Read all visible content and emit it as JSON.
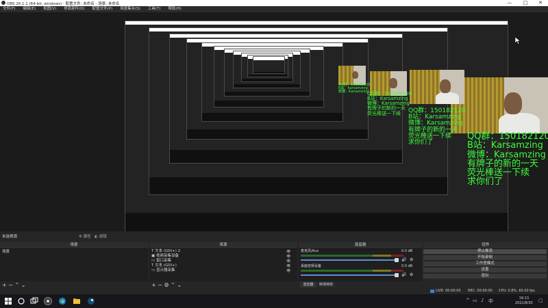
{
  "window": {
    "title": "OBS 26.1.1 (64-bit, windows) - 配置文件: 未命名 - 场景: 未命名",
    "minimize": "—",
    "maximize": "□",
    "close": "✕"
  },
  "menu": [
    "文件(F)",
    "编辑(E)",
    "视图(V)",
    "停靠部件(D)",
    "配置文件(P)",
    "场景集合(S)",
    "工具(T)",
    "帮助(H)"
  ],
  "preview": {
    "overlay_lines": [
      "QQ群：150182120",
      "B站：Karsamzing",
      "微博：Karsamzing",
      "有牌子的新的一天",
      "荧光棒送一下续",
      "求你们了"
    ],
    "text_color": "#3cff3c"
  },
  "dock": {
    "no_source": "未选择源",
    "properties_label": "属性",
    "filters_label": "滤镜",
    "scenes": {
      "title": "场景",
      "items": [
        "场景"
      ]
    },
    "sources": {
      "title": "来源",
      "items": [
        "文本 (GDI+) 2",
        "视频采集设备",
        "窗口采集",
        "文本 (GDI+)",
        "显示器采集"
      ]
    },
    "mixer": {
      "title": "混音器",
      "channels": [
        {
          "name": "麦克风/Aux",
          "db": "0.0 dB"
        },
        {
          "name": "桌面音频设备",
          "db": "0.0 dB"
        }
      ],
      "tabs": [
        "混音器",
        "转场特效"
      ]
    },
    "controls": {
      "title": "控件",
      "buttons": [
        "停止推流",
        "开始录制",
        "工作室模式",
        "设置",
        "退出"
      ]
    }
  },
  "status": {
    "live": "LIVE: 00:00:00",
    "rec": "REC: 00:00:00",
    "cpu": "CPU: 0.8%, 60.00 fps"
  },
  "taskbar": {
    "time": "19:13",
    "date": "2021/8/30"
  }
}
